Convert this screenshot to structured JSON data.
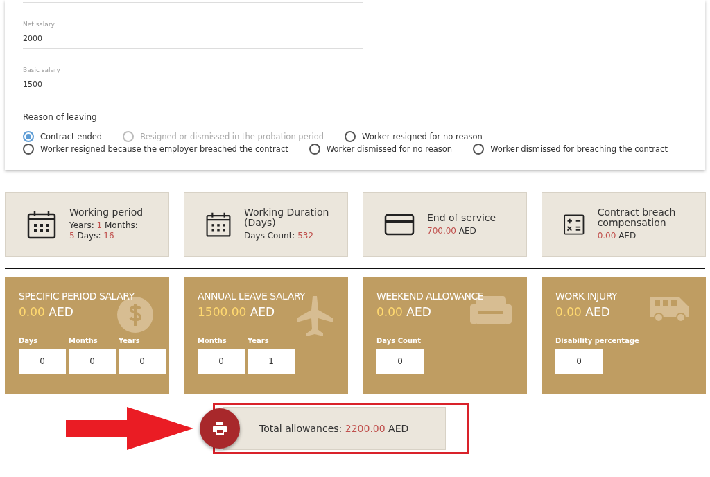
{
  "fields": [
    {
      "label": "Net salary",
      "value": "2000"
    },
    {
      "label": "Basic salary",
      "value": "1500"
    }
  ],
  "reason": {
    "label": "Reason of leaving",
    "options": [
      {
        "label": "Contract ended",
        "selected": true,
        "disabled": false
      },
      {
        "label": "Resigned or dismissed in the probation period",
        "selected": false,
        "disabled": true
      },
      {
        "label": "Worker resigned for no reason",
        "selected": false,
        "disabled": false
      },
      {
        "label": "Worker resigned because the employer breached the contract",
        "selected": false,
        "disabled": false
      },
      {
        "label": "Worker dismissed for no reason",
        "selected": false,
        "disabled": false
      },
      {
        "label": "Worker dismissed for breaching the contract",
        "selected": false,
        "disabled": false
      }
    ]
  },
  "summary_cards": [
    {
      "title": "Working period",
      "lines": [
        [
          {
            "text": "Years: ",
            "kind": "label"
          },
          {
            "text": "1",
            "kind": "value"
          },
          {
            "text": " Months: ",
            "kind": "label"
          }
        ],
        [
          {
            "text": "5",
            "kind": "value"
          },
          {
            "text": " Days: ",
            "kind": "label"
          },
          {
            "text": "16",
            "kind": "value"
          }
        ]
      ]
    },
    {
      "title": "Working Duration (Days)",
      "lines": [
        [
          {
            "text": "Days Count: ",
            "kind": "label"
          },
          {
            "text": "532",
            "kind": "value"
          }
        ]
      ]
    },
    {
      "title": "End of service",
      "lines": [
        [
          {
            "text": "700.00",
            "kind": "value"
          },
          {
            "text": " AED",
            "kind": "label"
          }
        ]
      ]
    },
    {
      "title": "Contract breach compensation",
      "lines": [
        [
          {
            "text": "0.00",
            "kind": "value"
          },
          {
            "text": " AED",
            "kind": "label"
          }
        ]
      ]
    }
  ],
  "allowance_cards": [
    {
      "title": "SPECIFIC PERIOD SALARY",
      "amount": "0.00",
      "currency": "AED",
      "inputs": [
        {
          "label": "Days",
          "value": "0"
        },
        {
          "label": "Months",
          "value": "0"
        },
        {
          "label": "Years",
          "value": "0"
        }
      ]
    },
    {
      "title": "ANNUAL LEAVE SALARY",
      "amount": "1500.00",
      "currency": "AED",
      "inputs": [
        {
          "label": "Months",
          "value": "0"
        },
        {
          "label": "Years",
          "value": "1"
        }
      ]
    },
    {
      "title": "WEEKEND ALLOWANCE",
      "amount": "0.00",
      "currency": "AED",
      "inputs": [
        {
          "label": "Days Count",
          "value": "0"
        }
      ]
    },
    {
      "title": "WORK INJURY",
      "amount": "0.00",
      "currency": "AED",
      "inputs": [
        {
          "label": "Disability percentage",
          "value": "0"
        }
      ]
    }
  ],
  "total": {
    "label": "Total allowances: ",
    "amount": "2200.00",
    "currency": " AED"
  }
}
